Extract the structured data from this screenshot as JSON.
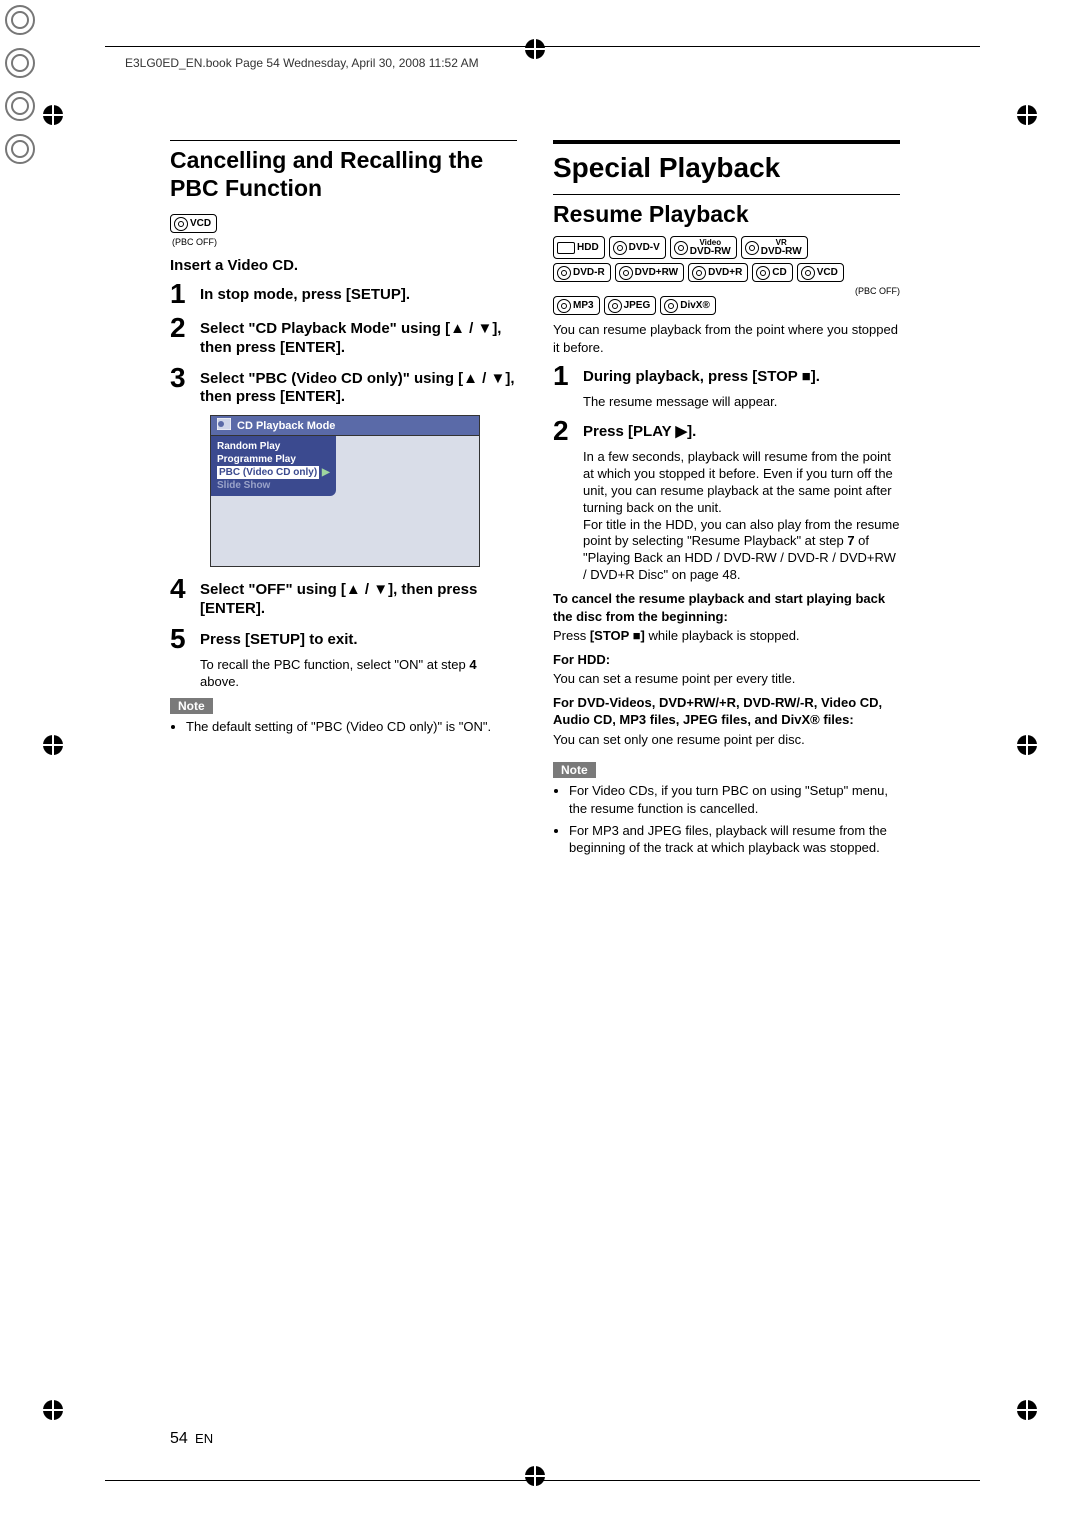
{
  "header": {
    "running_line": "E3LG0ED_EN.book  Page 54  Wednesday, April 30, 2008  11:52 AM"
  },
  "left": {
    "title": "Cancelling and Recalling the PBC Function",
    "badge_vcd": "VCD",
    "pbc_off": "(PBC OFF)",
    "intro": "Insert a Video CD.",
    "steps": {
      "s1": "In stop mode, press [SETUP].",
      "s2": "Select \"CD Playback Mode\" using [▲ / ▼], then press [ENTER].",
      "s3": "Select \"PBC (Video CD only)\" using [▲ / ▼], then press [ENTER].",
      "s4": "Select \"OFF\" using [▲ / ▼], then press [ENTER].",
      "s5": "Press [SETUP] to exit."
    },
    "menu": {
      "title": "CD Playback Mode",
      "items": {
        "random": "Random Play",
        "programme": "Programme Play",
        "pbc": "PBC (Video CD only)",
        "slide": "Slide Show"
      }
    },
    "s5_body_a": "To recall the PBC function, select \"ON\" at step ",
    "s5_body_b": "4",
    "s5_body_c": " above.",
    "note_label": "Note",
    "note_item": "The default setting of \"PBC (Video CD only)\" is \"ON\"."
  },
  "right": {
    "main_title": "Special Playback",
    "sub_title": "Resume Playback",
    "badges": {
      "hdd": "HDD",
      "dvdv": "DVD-V",
      "dvdrw_video_sup": "Video",
      "dvdrw_video": "DVD-RW",
      "dvdrw_vr_sup": "VR",
      "dvdrw_vr": "DVD-RW",
      "dvdr": "DVD-R",
      "dvdprw": "DVD+RW",
      "dvdpr": "DVD+R",
      "cd": "CD",
      "vcd": "VCD",
      "mp3": "MP3",
      "jpeg": "JPEG",
      "divx": "DivX®"
    },
    "pbc_off": "(PBC OFF)",
    "intro": "You can resume playback from the point where you stopped it before.",
    "steps": {
      "s1": "During playback, press [STOP ■].",
      "s1_body": "The resume message will appear.",
      "s2": "Press [PLAY ▶].",
      "s2_body_a": "In a few seconds, playback will resume from the point at which you stopped it before. Even if you turn off the unit, you can resume playback at the same point after turning back on the unit.",
      "s2_body_b": "For title in the HDD, you can also play from the resume point by selecting \"Resume Playback\" at step ",
      "s2_body_bold7": "7",
      "s2_body_c": " of \"Playing Back an HDD / DVD-RW / DVD-R / DVD+RW / DVD+R Disc\" on page 48."
    },
    "cancel_bold": "To cancel the resume playback and start playing back the disc from the beginning:",
    "cancel_line_a": "Press ",
    "cancel_line_b": "[STOP ■]",
    "cancel_line_c": " while playback is stopped.",
    "for_hdd_label": "For HDD:",
    "for_hdd_body": "You can set a resume point per every title.",
    "for_other_label": "For DVD-Videos, DVD+RW/+R, DVD-RW/-R, Video CD, Audio CD, MP3 files, JPEG files, and DivX® files:",
    "for_other_body": "You can set only one resume point per disc.",
    "note_label": "Note",
    "notes": {
      "n1": "For Video CDs, if you turn PBC on using \"Setup\" menu, the resume function is cancelled.",
      "n2": "For MP3 and JPEG files, playback will resume from the beginning of the track at which playback was stopped."
    }
  },
  "footer": {
    "page_num": "54",
    "lang": "EN"
  }
}
